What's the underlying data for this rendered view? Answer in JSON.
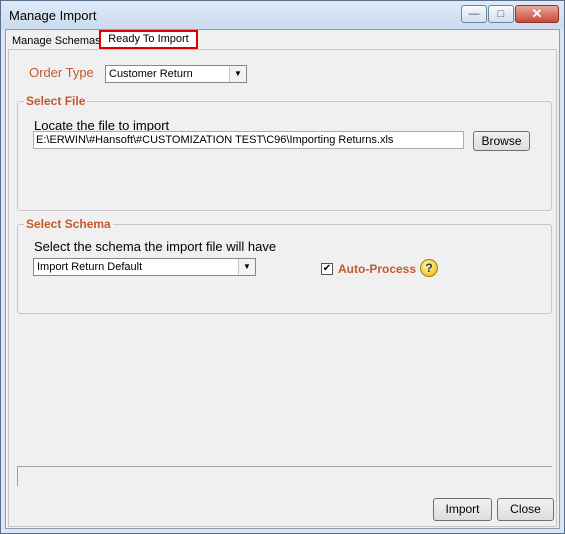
{
  "window": {
    "title": "Manage Import",
    "controls": {
      "minimize": "—",
      "maximize": "□",
      "close": "✕"
    }
  },
  "tabs": [
    {
      "label": "Manage Schemas",
      "selected": false
    },
    {
      "label": "Ready To Import",
      "selected": true
    }
  ],
  "order_type": {
    "label": "Order Type",
    "value": "Customer Return"
  },
  "select_file": {
    "title": "Select File",
    "hint": "Locate the file to import",
    "path": "E:\\ERWIN\\#Hansoft\\#CUSTOMIZATION TEST\\C96\\Importing Returns.xls",
    "browse_label": "Browse"
  },
  "select_schema": {
    "title": "Select Schema",
    "hint": "Select the schema the import file will have",
    "value": "Import Return Default",
    "auto_process_label": "Auto-Process",
    "auto_process_checked": true,
    "help_symbol": "?"
  },
  "footer": {
    "import_label": "Import",
    "close_label": "Close"
  },
  "colors": {
    "accent_label": "#c45a2b",
    "tab_highlight": "#e00000"
  }
}
